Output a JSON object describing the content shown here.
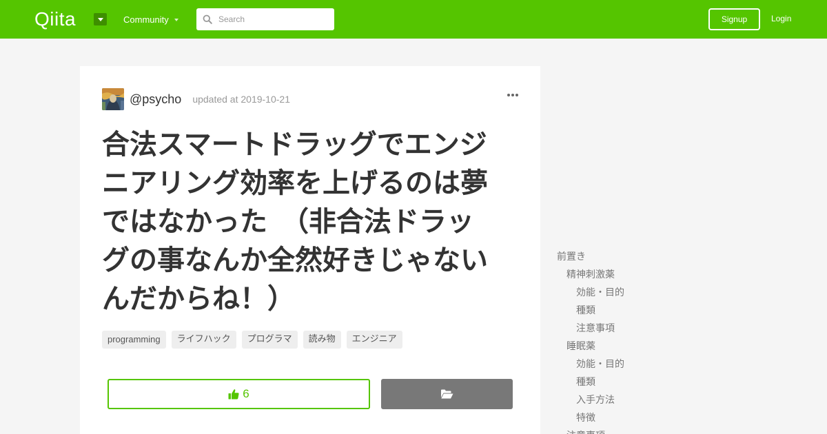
{
  "header": {
    "logo": "Qiita",
    "community_label": "Community",
    "search_placeholder": "Search",
    "signup_label": "Signup",
    "login_label": "Login",
    "brand_color": "#55c500"
  },
  "article": {
    "author": "@psycho",
    "updated": "updated at 2019-10-21",
    "title_lines": [
      "合法スマートドラッグでエンジ",
      "ニアリング効率を上げるのは夢",
      "ではなかった　（非合法ドラッ",
      "グの事なんか全然好きじゃない",
      "んだからね！）"
    ],
    "tags": [
      "programming",
      "ライフハック",
      "プログラマ",
      "読み物",
      "エンジニア"
    ],
    "like_count": "6"
  },
  "toc": {
    "items": [
      {
        "label": "前置き",
        "level": 1
      },
      {
        "label": "精神刺激薬",
        "level": 2
      },
      {
        "label": "効能・目的",
        "level": 3
      },
      {
        "label": "種類",
        "level": 3
      },
      {
        "label": "注意事項",
        "level": 3
      },
      {
        "label": "睡眠薬",
        "level": 2
      },
      {
        "label": "効能・目的",
        "level": 3
      },
      {
        "label": "種類",
        "level": 3
      },
      {
        "label": "入手方法",
        "level": 3
      },
      {
        "label": "特徴",
        "level": 3
      },
      {
        "label": "注意事項",
        "level": 2
      }
    ]
  }
}
